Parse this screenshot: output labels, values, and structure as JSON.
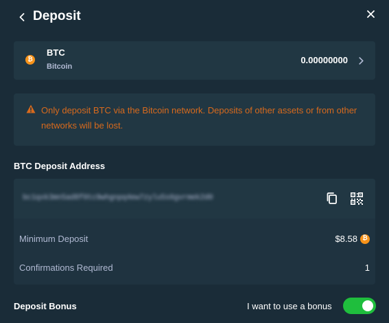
{
  "header": {
    "title": "Deposit"
  },
  "asset": {
    "code": "BTC",
    "name": "Bitcoin",
    "balance": "0.00000000",
    "coin_symbol": "₿"
  },
  "warning": {
    "text": "Only deposit BTC via the Bitcoin network. Deposits of other assets or from other networks will be lost."
  },
  "address": {
    "label": "BTC Deposit Address",
    "value": "bc1qxk3mn5ad8f0tc9whgnpq4ew7zylu5s6gvrmek2d0"
  },
  "info": {
    "minimum_label": "Minimum Deposit",
    "minimum_value": "$8.58",
    "confirmations_label": "Confirmations Required",
    "confirmations_value": "1"
  },
  "bonus": {
    "label": "Deposit Bonus",
    "toggle_label": "I want to use a bonus",
    "enabled": true
  },
  "colors": {
    "background": "#1a2c38",
    "panel": "#213743",
    "muted_text": "#b1bad3",
    "warning": "#d86a1d",
    "toggle_on": "#1fbe3d",
    "btc": "#f7931a"
  }
}
